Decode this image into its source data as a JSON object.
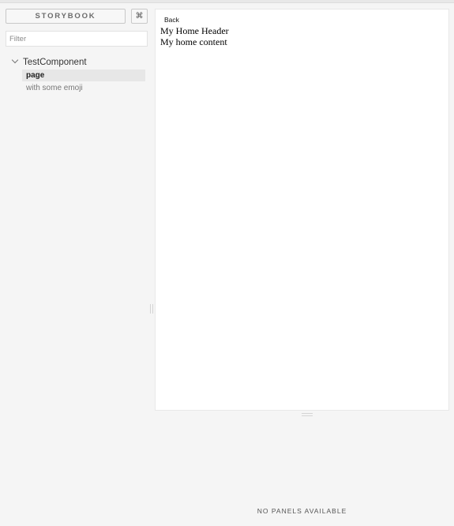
{
  "header": {
    "brand_label": "STORYBOOK",
    "shortcuts_label": "⌘"
  },
  "sidebar": {
    "filter": {
      "placeholder": "Filter",
      "value": ""
    },
    "tree": {
      "group_label": "TestComponent",
      "expanded": true,
      "stories": [
        {
          "label": "page",
          "selected": true
        },
        {
          "label": "with some emoji",
          "selected": false
        }
      ]
    }
  },
  "preview": {
    "back_label": "Back",
    "header_text": "My Home Header",
    "content_text": "My home content"
  },
  "addons": {
    "empty_message": "NO PANELS AVAILABLE"
  },
  "colors": {
    "background": "#f5f5f5",
    "preview_background": "#ffffff",
    "selected_item_background": "#e7e7e7"
  }
}
